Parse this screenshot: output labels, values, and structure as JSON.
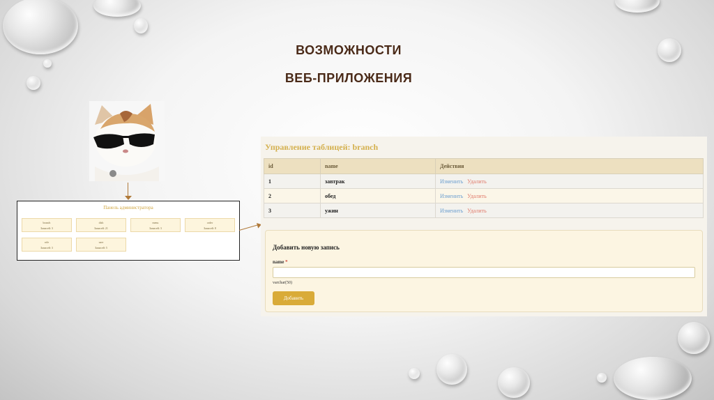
{
  "slide": {
    "title_line1": "ВОЗМОЖНОСТИ",
    "title_line2": "ВЕБ-ПРИЛОЖЕНИЯ"
  },
  "admin_panel": {
    "title": "Панель администратора",
    "cards": [
      {
        "name": "branch",
        "sub": "Записей: 3"
      },
      {
        "name": "dish",
        "sub": "Записей: 21"
      },
      {
        "name": "menu",
        "sub": "Записей: 3"
      },
      {
        "name": "order",
        "sub": "Записей: 8"
      },
      {
        "name": "role",
        "sub": "Записей: 3"
      },
      {
        "name": "user",
        "sub": "Записей: 5"
      }
    ]
  },
  "table_panel": {
    "title": "Управление таблицей: branch",
    "columns": [
      "id",
      "name",
      "Действия"
    ],
    "rows": [
      {
        "id": "1",
        "name": "завтрак"
      },
      {
        "id": "2",
        "name": "обед"
      },
      {
        "id": "3",
        "name": "ужин"
      }
    ],
    "edit_label": "Изменить",
    "delete_label": "Удалить",
    "edit_color": "#6b9ecf",
    "delete_color": "#e07a6a"
  },
  "add_form": {
    "heading": "Добавить новую запись",
    "field_label": "name",
    "required_mark": "*",
    "field_value": "",
    "type_hint": "varchar(50)",
    "submit_label": "Добавить",
    "accent_color": "#d9ab38"
  }
}
